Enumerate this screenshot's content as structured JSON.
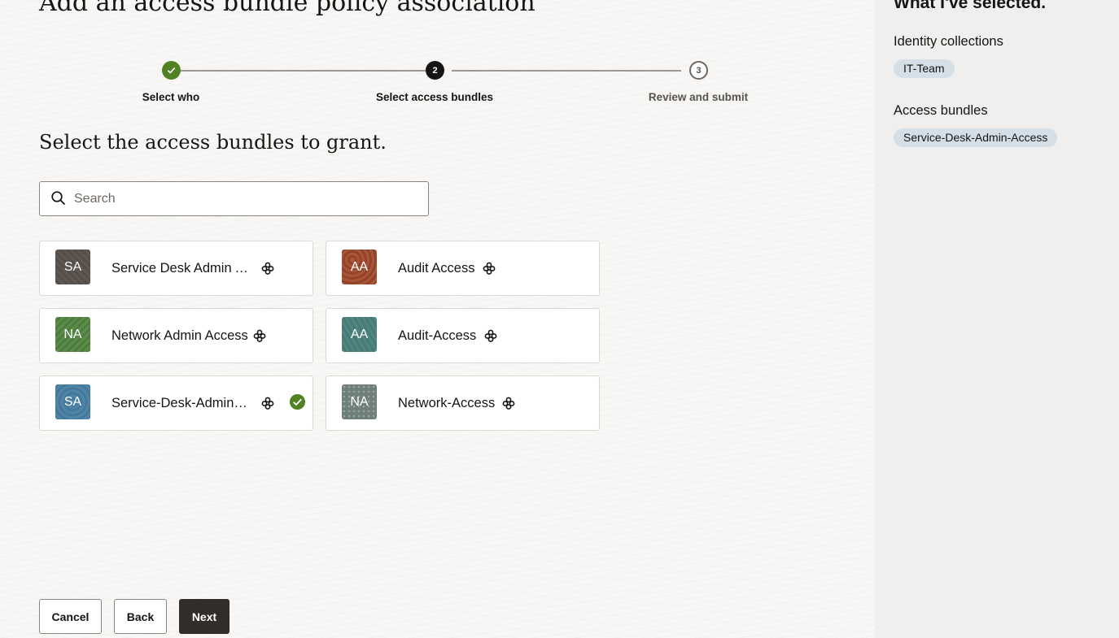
{
  "page": {
    "title": "Add an access bundle policy association",
    "section_heading": "Select the access bundles to grant."
  },
  "stepper": {
    "steps": [
      {
        "label": "Select who",
        "state": "done",
        "marker": ""
      },
      {
        "label": "Select access bundles",
        "state": "current",
        "marker": "2"
      },
      {
        "label": "Review and submit",
        "state": "future",
        "marker": "3"
      }
    ]
  },
  "search": {
    "placeholder": "Search",
    "value": ""
  },
  "bundles": [
    {
      "initials": "SA",
      "name": "Service Desk Admin Access",
      "selected": false
    },
    {
      "initials": "AA",
      "name": "Audit Access",
      "selected": false
    },
    {
      "initials": "NA",
      "name": "Network Admin Access",
      "selected": false
    },
    {
      "initials": "AA",
      "name": "Audit-Access",
      "selected": false
    },
    {
      "initials": "SA",
      "name": "Service-Desk-Admin-Access",
      "selected": true
    },
    {
      "initials": "NA",
      "name": "Network-Access",
      "selected": false
    }
  ],
  "buttons": {
    "cancel": "Cancel",
    "back": "Back",
    "next": "Next"
  },
  "sidebar": {
    "title": "What I've selected.",
    "identity_heading": "Identity collections",
    "identity_items": [
      "IT-Team"
    ],
    "bundles_heading": "Access bundles",
    "bundle_items": [
      "Service-Desk-Admin-Access"
    ]
  },
  "colors": {
    "success": "#508223",
    "primary_button": "#312d2a",
    "chip": "#d4dfe7"
  },
  "icons": [
    "check-icon",
    "search-icon",
    "bundle-icon"
  ]
}
